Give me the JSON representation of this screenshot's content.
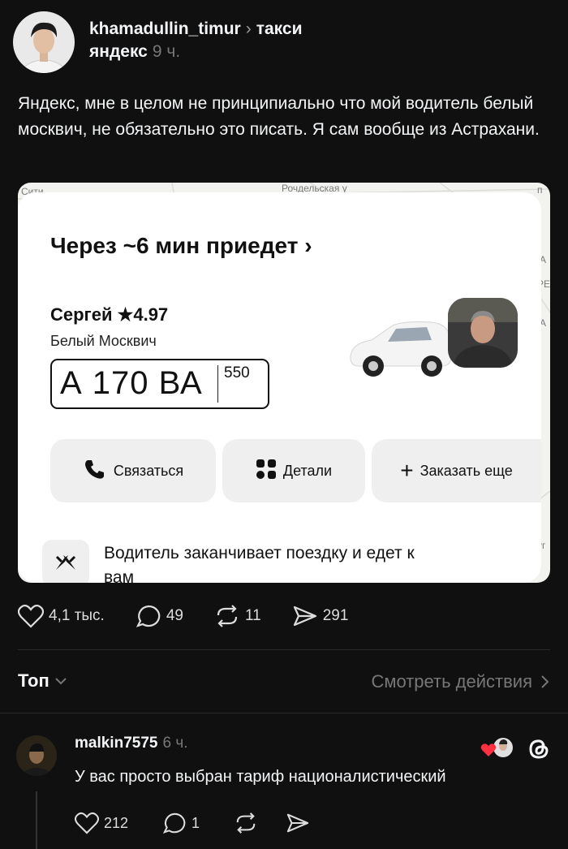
{
  "post": {
    "username": "khamadullin_timur",
    "topic": "такси",
    "topic_line2": "яндекс",
    "time": "9 ч.",
    "text": "Яндекс, мне в целом не принципиально что мой водитель белый москвич, не обязательно это писать. Я сам вообще из Астрахани."
  },
  "screenshot": {
    "map_labels": [
      "Сити",
      "ск",
      "Рочдельская у",
      "п",
      "А",
      "РЕ",
      "А",
      "уз",
      "уг"
    ],
    "eta": "Через ~6 мин приедет",
    "driver": "Сергей",
    "rating": "4.97",
    "car": "Белый Москвич",
    "plate_number": "А 170 ВА",
    "plate_region": "550",
    "buttons": {
      "contact": "Связаться",
      "details": "Детали",
      "order_more": "Заказать еще"
    },
    "notice": "Водитель заканчивает поездку и едет к вам"
  },
  "actions": {
    "likes": "4,1 тыс.",
    "comments": "49",
    "reposts": "11",
    "shares": "291"
  },
  "filter": {
    "sort": "Топ",
    "view_activity": "Смотреть действия"
  },
  "comment": {
    "username": "malkin7575",
    "time": "6 ч.",
    "text": "У вас просто выбран тариф националистический",
    "likes": "212",
    "replies": "1"
  },
  "colors": {
    "background": "#101010",
    "text": "#f3f5f7",
    "muted": "#777777",
    "like_red": "#ff3040"
  },
  "icons": [
    "heart-icon",
    "comment-icon",
    "repost-icon",
    "share-icon",
    "chevron-down-icon",
    "chevron-right-icon",
    "threads-logo-icon",
    "star-icon",
    "phone-icon",
    "grid-icon",
    "plus-icon",
    "flags-icon"
  ]
}
